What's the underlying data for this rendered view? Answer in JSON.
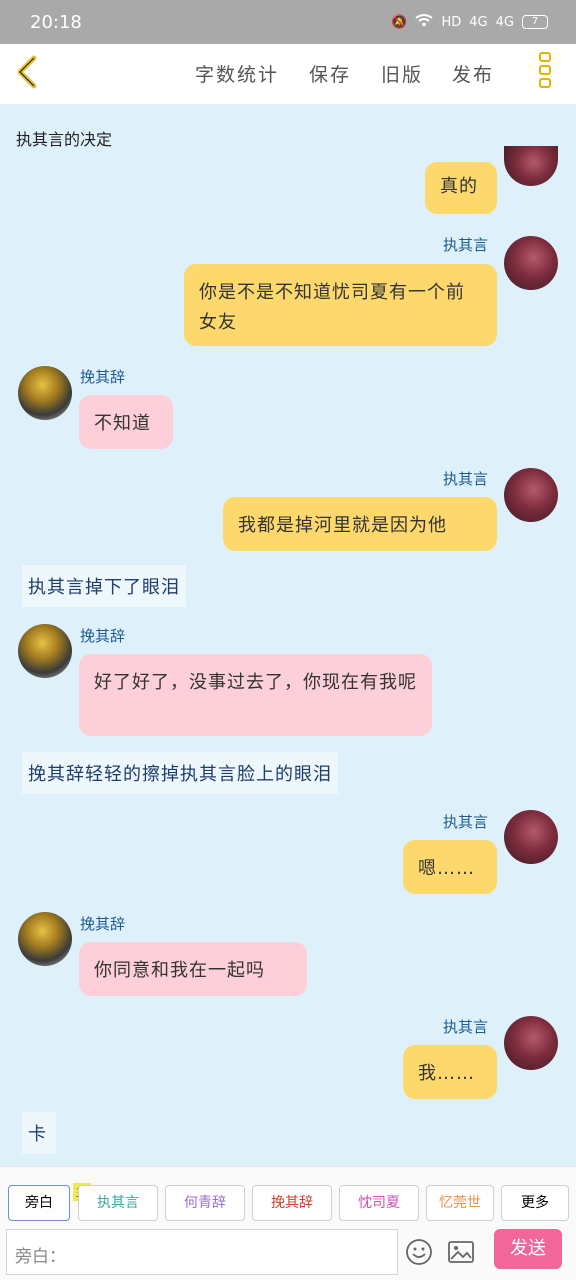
{
  "status_bar": {
    "time": "20:18",
    "indicators": [
      "HD",
      "4G",
      "4G"
    ],
    "battery": "7"
  },
  "top_bar": {
    "back_icon": "chevron-left-icon",
    "menu": [
      "字数统计",
      "保存",
      "旧版",
      "发布"
    ],
    "more_icon": "more-vertical-icon"
  },
  "chat": {
    "title": "执其言的决定",
    "messages": [
      {
        "type": "right",
        "text": "真的"
      },
      {
        "type": "right",
        "name": "执其言",
        "text": "你是不是不知道忧司夏有一个前女友"
      },
      {
        "type": "left",
        "name": "挽其辞",
        "text": "不知道"
      },
      {
        "type": "right",
        "name": "执其言",
        "text": "我都是掉河里就是因为他"
      },
      {
        "type": "narration",
        "text": "执其言掉下了眼泪"
      },
      {
        "type": "left",
        "name": "挽其辞",
        "text": "好了好了，没事过去了，你现在有我呢"
      },
      {
        "type": "narration",
        "text": "挽其辞轻轻的擦掉执其言脸上的眼泪"
      },
      {
        "type": "right",
        "name": "执其言",
        "text": "嗯……"
      },
      {
        "type": "left",
        "name": "挽其辞",
        "text": "你同意和我在一起吗"
      },
      {
        "type": "right",
        "name": "执其言",
        "text": "我……"
      },
      {
        "type": "narration",
        "text": "卡"
      }
    ]
  },
  "bottom": {
    "roles": [
      {
        "label": "旁白",
        "color": "#444444"
      },
      {
        "label": "执其言",
        "color": "#3aa6a0"
      },
      {
        "label": "何青辞",
        "color": "#9a6fd0"
      },
      {
        "label": "挽其辞",
        "color": "#d0402f"
      },
      {
        "label": "忱司夏",
        "color": "#d04fb0"
      },
      {
        "label": "忆莞世",
        "color": "#e6944a"
      },
      {
        "label": "更多",
        "color": "#444444"
      }
    ],
    "main_badge": "主",
    "input_placeholder": "旁白：",
    "emoji_icon": "smiley-icon",
    "image_icon": "image-icon",
    "send_label": "发送"
  }
}
